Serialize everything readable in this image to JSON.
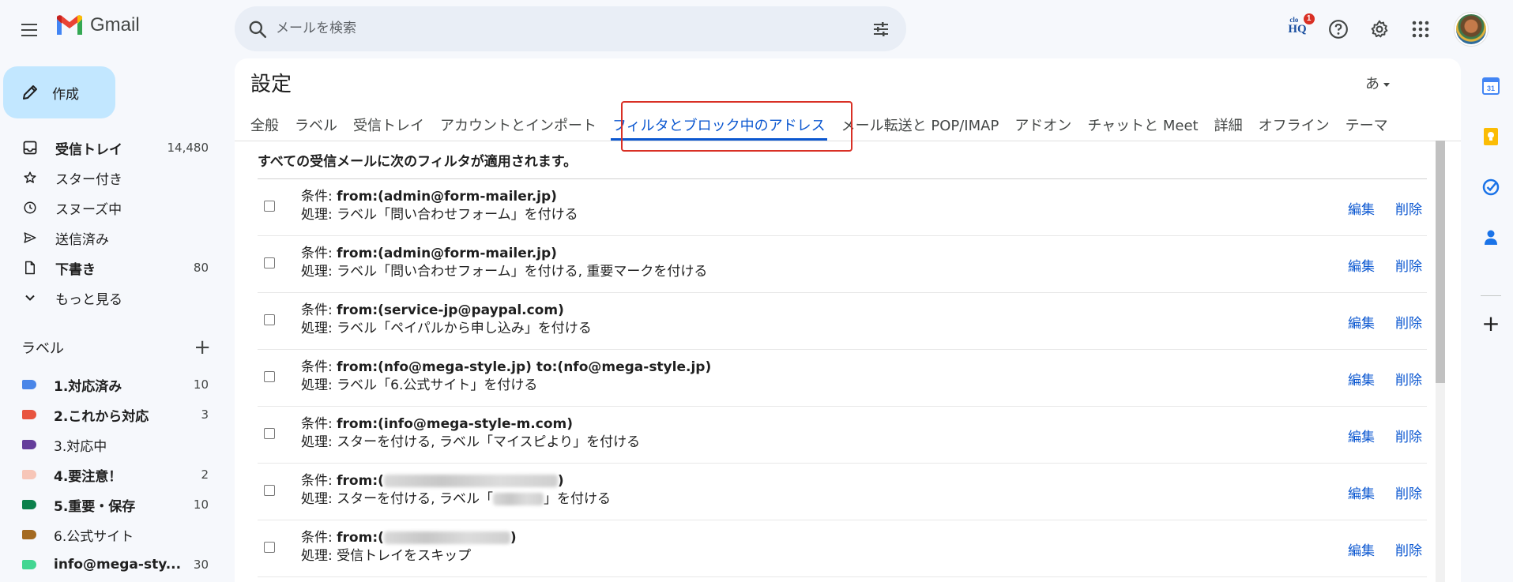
{
  "app": {
    "name": "Gmail"
  },
  "search": {
    "placeholder": "メールを検索"
  },
  "compose": {
    "label": "作成"
  },
  "nav": [
    {
      "label": "受信トレイ",
      "count": "14,480",
      "bold": true,
      "icon": "inbox-icon"
    },
    {
      "label": "スター付き",
      "count": "",
      "bold": false,
      "icon": "star-icon"
    },
    {
      "label": "スヌーズ中",
      "count": "",
      "bold": false,
      "icon": "clock-icon"
    },
    {
      "label": "送信済み",
      "count": "",
      "bold": false,
      "icon": "send-icon"
    },
    {
      "label": "下書き",
      "count": "80",
      "bold": true,
      "icon": "draft-icon"
    },
    {
      "label": "もっと見る",
      "count": "",
      "bold": false,
      "icon": "chevron-down-icon"
    }
  ],
  "labels_section": {
    "title": "ラベル",
    "add": "+"
  },
  "labels": [
    {
      "name": "1.対応済み",
      "count": "10",
      "color": "#4a86e8",
      "bold": true
    },
    {
      "name": "2.これから対応",
      "count": "3",
      "color": "#e8543f",
      "bold": true
    },
    {
      "name": "3.対応中",
      "count": "",
      "color": "#653e9b",
      "bold": false
    },
    {
      "name": "4.要注意！",
      "count": "2",
      "color": "#f7c6b8",
      "bold": true
    },
    {
      "name": "5.重要・保存",
      "count": "10",
      "color": "#0b804b",
      "bold": true
    },
    {
      "name": "6.公式サイト",
      "count": "",
      "color": "#a46a21",
      "bold": false
    },
    {
      "name": "info@mega-sty...",
      "count": "30",
      "color": "#43d692",
      "bold": true
    }
  ],
  "settings": {
    "title": "設定",
    "ime": "あ",
    "tabs": [
      {
        "label": "全般",
        "active": false
      },
      {
        "label": "ラベル",
        "active": false
      },
      {
        "label": "受信トレイ",
        "active": false
      },
      {
        "label": "アカウントとインポート",
        "active": false
      },
      {
        "label": "フィルタとブロック中のアドレス",
        "active": true
      },
      {
        "label": "メール転送と POP/IMAP",
        "active": false
      },
      {
        "label": "アドオン",
        "active": false
      },
      {
        "label": "チャットと Meet",
        "active": false
      },
      {
        "label": "詳細",
        "active": false
      },
      {
        "label": "オフライン",
        "active": false
      },
      {
        "label": "テーマ",
        "active": false
      }
    ],
    "filters_heading": "すべての受信メールに次のフィルタが適用されます。",
    "edit_label": "編集",
    "delete_label": "削除",
    "cond_prefix": "条件: ",
    "action_prefix": "処理: ",
    "filters": [
      {
        "condition": "from:(admin@form-mailer.jp)",
        "action": "ラベル「問い合わせフォーム」を付ける"
      },
      {
        "condition": "from:(admin@form-mailer.jp)",
        "action": "ラベル「問い合わせフォーム」を付ける, 重要マークを付ける"
      },
      {
        "condition": "from:(service-jp@paypal.com)",
        "action": "ラベル「ペイパルから申し込み」を付ける"
      },
      {
        "condition": "from:(nfo@mega-style.jp) to:(nfo@mega-style.jp)",
        "action": "ラベル「6.公式サイト」を付ける"
      },
      {
        "condition": "from:(info@mega-style-m.com)",
        "action": "スターを付ける, ラベル「マイスピより」を付ける"
      },
      {
        "condition_pre": "from:(",
        "condition_post": ")",
        "action_pre": "スターを付ける, ラベル「",
        "action_post": "」を付ける",
        "blurred": true
      },
      {
        "condition_pre": "from:(",
        "condition_post": ")",
        "action": "受信トレイをスキップ",
        "blurred_cond_only": true
      }
    ]
  },
  "colors": {
    "accent": "#0b57d0",
    "highlight_border": "#d93025",
    "compose_bg": "#c2e7ff"
  }
}
